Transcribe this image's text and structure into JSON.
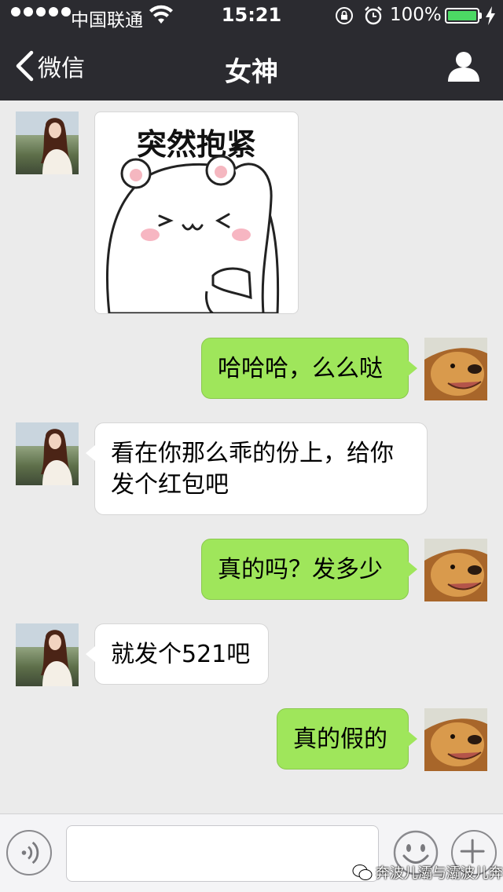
{
  "status_bar": {
    "carrier": "中国联通",
    "time": "15:21",
    "battery_percent": "100%"
  },
  "nav": {
    "back_label": "微信",
    "title": "女神"
  },
  "messages": [
    {
      "side": "in",
      "type": "sticker",
      "text": "突然抱紧"
    },
    {
      "side": "out",
      "type": "text",
      "text": "哈哈哈，么么哒"
    },
    {
      "side": "in",
      "type": "text",
      "text": "看在你那么乖的份上，给你发个红包吧"
    },
    {
      "side": "out",
      "type": "text",
      "text": "真的吗？发多少"
    },
    {
      "side": "in",
      "type": "text",
      "text": "就发个521吧"
    },
    {
      "side": "out",
      "type": "text",
      "text": "真的假的"
    }
  ],
  "input": {
    "value": "",
    "placeholder": ""
  },
  "watermark": "奔波儿灞与灞波儿奔",
  "colors": {
    "nav_background": "#2b2b30",
    "chat_background": "#ebebeb",
    "outgoing_bubble": "#9fe65b",
    "incoming_bubble": "#ffffff",
    "battery_fill": "#4cd964"
  },
  "icons": {
    "back": "chevron-left-icon",
    "profile": "person-icon",
    "voice": "voice-icon",
    "emoji": "emoji-icon",
    "plus": "plus-icon",
    "wifi": "wifi-icon",
    "lock": "rotation-lock-icon",
    "alarm": "alarm-icon",
    "charge": "charging-icon"
  }
}
